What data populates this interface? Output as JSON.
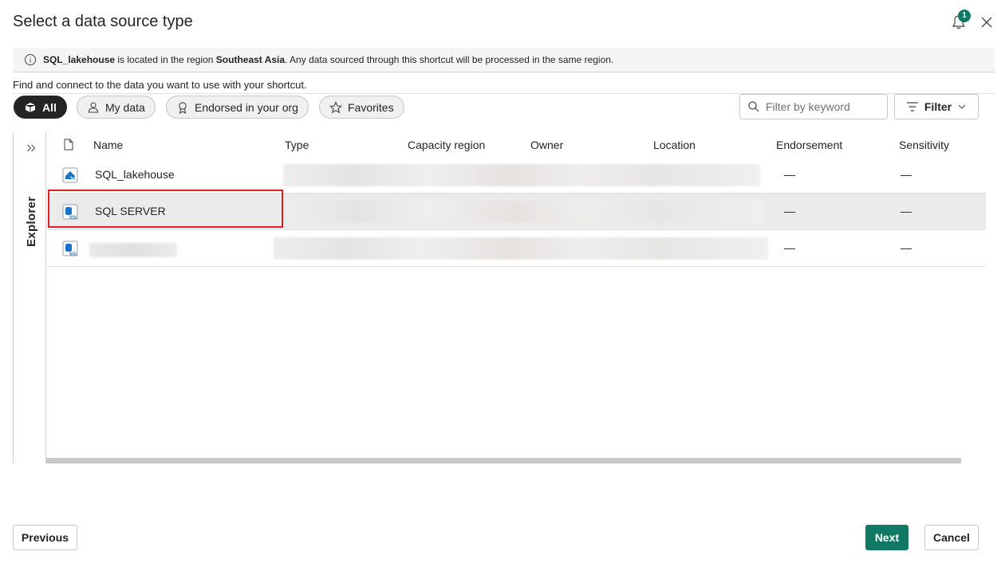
{
  "dialog": {
    "title": "Select a data source type",
    "notification_count": "1"
  },
  "info": {
    "item": "SQL_lakehouse",
    "text1": " is located in the region ",
    "region": "Southeast Asia",
    "text2": ". Any data sourced through this shortcut will be processed in the same region."
  },
  "description": "Find and connect to the data you want to use with your shortcut.",
  "filters": {
    "pills": [
      {
        "label": "All",
        "icon": "cube-icon",
        "active": true
      },
      {
        "label": "My data",
        "icon": "person-icon",
        "active": false
      },
      {
        "label": "Endorsed in your org",
        "icon": "ribbon-icon",
        "active": false
      },
      {
        "label": "Favorites",
        "icon": "star-icon",
        "active": false
      }
    ],
    "search_placeholder": "Filter by keyword",
    "filter_label": "Filter"
  },
  "explorer": {
    "label": "Explorer"
  },
  "table": {
    "columns": [
      "Name",
      "Type",
      "Capacity region",
      "Owner",
      "Location",
      "Endorsement",
      "Sensitivity"
    ],
    "rows": [
      {
        "name": "SQL_lakehouse",
        "icon": "lakehouse-icon",
        "endorsement": "—",
        "sensitivity": "—",
        "selected": false
      },
      {
        "name": "SQL SERVER",
        "icon": "sql-database-icon",
        "endorsement": "—",
        "sensitivity": "—",
        "selected": true
      },
      {
        "name": "",
        "icon": "sql-database-icon",
        "endorsement": "—",
        "sensitivity": "—",
        "selected": false
      }
    ]
  },
  "footer": {
    "previous": "Previous",
    "next": "Next",
    "cancel": "Cancel"
  },
  "colors": {
    "primary": "#117865",
    "highlight": "#e02020"
  }
}
